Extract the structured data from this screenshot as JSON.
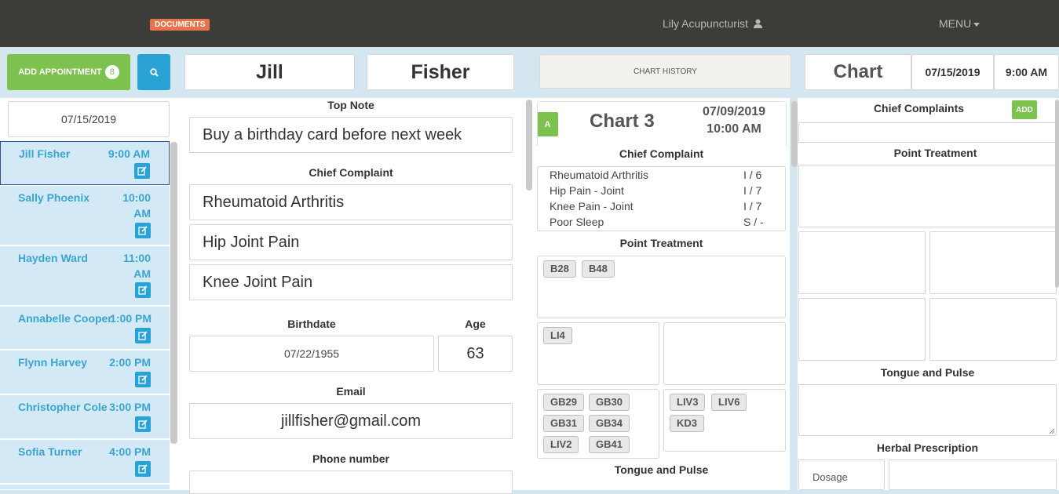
{
  "header": {
    "documents_badge": "DOCUMENTS",
    "user_name": "Lily Acupuncturist",
    "menu_label": "MENU"
  },
  "toolbar": {
    "add_appointment_label": "ADD APPOINTMENT",
    "appointment_count": "8",
    "patient_first_name": "Jill",
    "patient_last_name": "Fisher",
    "chart_history_label": "CHART HISTORY",
    "chart_label": "Chart",
    "chart_date": "07/15/2019",
    "chart_time": "9:00 AM"
  },
  "schedule": {
    "date": "07/15/2019",
    "appointments": [
      {
        "name": "Jill Fisher",
        "time": "9:00 AM"
      },
      {
        "name": "Sally Phoenix",
        "time": "10:00 AM"
      },
      {
        "name": "Hayden Ward",
        "time": "11:00 AM"
      },
      {
        "name": "Annabelle Cooper",
        "time": "1:00 PM"
      },
      {
        "name": "Flynn Harvey",
        "time": "2:00 PM"
      },
      {
        "name": "Christopher Cole",
        "time": "3:00 PM"
      },
      {
        "name": "Sofia Turner",
        "time": "4:00 PM"
      }
    ]
  },
  "patient": {
    "top_note_label": "Top Note",
    "top_note": "Buy a birthday card before next week",
    "chief_complaint_label": "Chief Complaint",
    "complaints": [
      "Rheumatoid Arthritis",
      "Hip Joint Pain",
      "Knee Joint Pain"
    ],
    "birthdate_label": "Birthdate",
    "birthdate": "07/22/1955",
    "age_label": "Age",
    "age": "63",
    "email_label": "Email",
    "email": "jillfisher@gmail.com",
    "phone_label": "Phone number"
  },
  "previous_chart": {
    "badge": "A",
    "title": "Chart 3",
    "date": "07/09/2019",
    "time": "10:00 AM",
    "chief_complaint_label": "Chief Complaint",
    "complaints": [
      {
        "name": "Rheumatoid Arthritis",
        "score": "I / 6"
      },
      {
        "name": "Hip Pain - Joint",
        "score": "I / 7"
      },
      {
        "name": "Knee Pain - Joint",
        "score": "I / 7"
      },
      {
        "name": "Poor Sleep",
        "score": "S / -"
      }
    ],
    "point_treatment_label": "Point Treatment",
    "points_top": [
      "B28",
      "B48"
    ],
    "points_mid_left": [
      "LI4"
    ],
    "points_bot_left": [
      "GB29",
      "GB30",
      "GB31",
      "GB34",
      "LIV2",
      "GB41"
    ],
    "points_bot_right": [
      "LIV3",
      "LIV6",
      "KD3"
    ],
    "tongue_pulse_label": "Tongue and Pulse"
  },
  "current_chart": {
    "chief_complaints_label": "Chief Complaints",
    "add_label": "ADD",
    "point_treatment_label": "Point Treatment",
    "tongue_pulse_label": "Tongue and Pulse",
    "herbal_label": "Herbal Prescription",
    "dosage_label": "Dosage"
  }
}
